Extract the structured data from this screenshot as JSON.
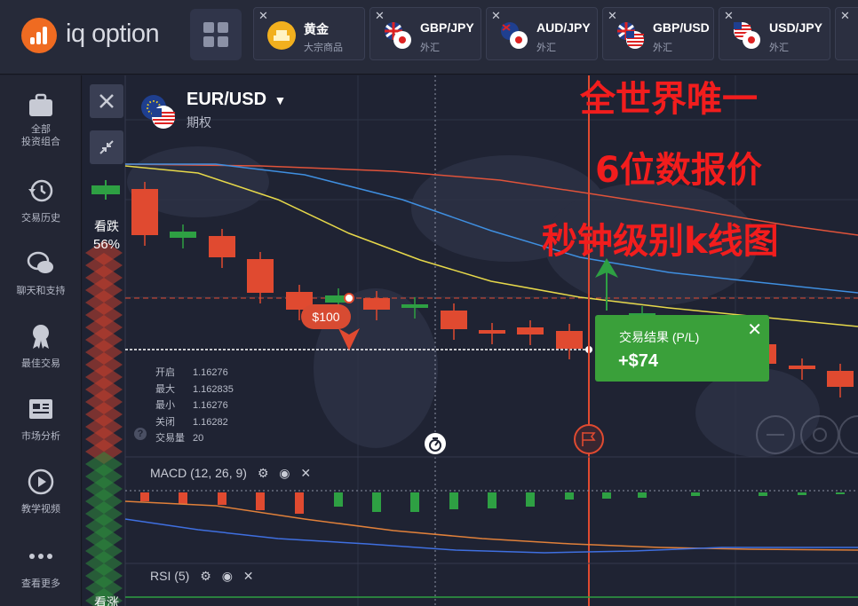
{
  "brand": {
    "name": "iq option",
    "color": "#ef6b21"
  },
  "asset_tabs": [
    {
      "name": "黄金",
      "type": "大宗商品",
      "flag": "gold-icon"
    },
    {
      "name": "GBP/JPY",
      "type": "外汇",
      "flag": "gbp-jpy-flags"
    },
    {
      "name": "AUD/JPY",
      "type": "外汇",
      "flag": "aud-jpy-flags"
    },
    {
      "name": "GBP/USD",
      "type": "外汇",
      "flag": "gbp-usd-flags"
    },
    {
      "name": "USD/JPY",
      "type": "外汇",
      "flag": "usd-jpy-flags"
    }
  ],
  "sidebar": {
    "items": [
      {
        "label": "全部\n投资组合",
        "icon": "briefcase-icon"
      },
      {
        "label": "交易历史",
        "icon": "history-icon"
      },
      {
        "label": "聊天和支持",
        "icon": "chat-icon"
      },
      {
        "label": "最佳交易",
        "icon": "award-icon"
      },
      {
        "label": "市场分析",
        "icon": "news-icon"
      },
      {
        "label": "教学视频",
        "icon": "play-icon"
      },
      {
        "label": "查看更多",
        "icon": "more-icon"
      }
    ]
  },
  "chart": {
    "asset_name": "EUR/USD",
    "asset_type": "期权",
    "sell_label": "看跌",
    "sell_pct": "56%",
    "buy_label": "看涨",
    "bet_amount": "$100",
    "pl_title": "交易结果 (P/L)",
    "pl_value": "+$74",
    "ohlc": [
      {
        "k": "开启",
        "v": "1.16276"
      },
      {
        "k": "最大",
        "v": "1.162835"
      },
      {
        "k": "最小",
        "v": "1.16276"
      },
      {
        "k": "关闭",
        "v": "1.16282"
      },
      {
        "k": "交易量",
        "v": "20"
      }
    ],
    "help_icon": "?",
    "indicators": [
      {
        "name": "MACD (12, 26, 9)"
      },
      {
        "name": "RSI (5)"
      }
    ],
    "promo": [
      "全世界唯一",
      "6位数报价",
      "秒钟级别k线图"
    ],
    "colors": {
      "up": "#2ea043",
      "down": "#e04a30",
      "ma_red": "#e0533a",
      "ma_blue": "#3f8fe0",
      "ma_yellow": "#e6d84a",
      "promo": "#f21d1d"
    }
  }
}
